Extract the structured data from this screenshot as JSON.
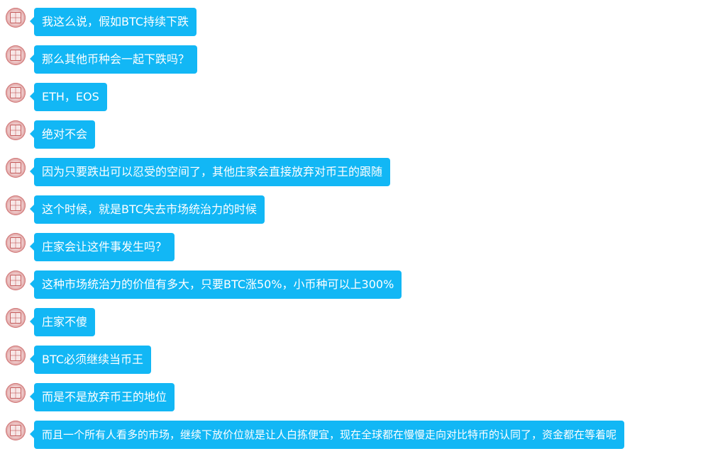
{
  "colors": {
    "bubble_background": "#12b7f5",
    "bubble_text": "#ffffff",
    "page_background": "#ffffff"
  },
  "messages": [
    {
      "text": "我这么说，假如BTC持续下跌",
      "avatar_icon": "seal-avatar-icon"
    },
    {
      "text": "那么其他币种会一起下跌吗？",
      "avatar_icon": "seal-avatar-icon"
    },
    {
      "text": "ETH，EOS",
      "avatar_icon": "seal-avatar-icon"
    },
    {
      "text": "绝对不会",
      "avatar_icon": "seal-avatar-icon"
    },
    {
      "text": "因为只要跌出可以忍受的空间了，其他庄家会直接放弃对币王的跟随",
      "avatar_icon": "seal-avatar-icon"
    },
    {
      "text": "这个时候，就是BTC失去市场统治力的时候",
      "avatar_icon": "seal-avatar-icon"
    },
    {
      "text": "庄家会让这件事发生吗？",
      "avatar_icon": "seal-avatar-icon"
    },
    {
      "text": "这种市场统治力的价值有多大，只要BTC涨50%，小币种可以上300%",
      "avatar_icon": "seal-avatar-icon"
    },
    {
      "text": "庄家不傻",
      "avatar_icon": "seal-avatar-icon"
    },
    {
      "text": "BTC必须继续当币王",
      "avatar_icon": "seal-avatar-icon"
    },
    {
      "text": "而是不是放弃币王的地位",
      "avatar_icon": "seal-avatar-icon"
    },
    {
      "text": "而且一个所有人看多的市场，继续下放价位就是让人白拣便宜，现在全球都在慢慢走向对比特币的认同了，资金都在等着呢",
      "avatar_icon": "seal-avatar-icon"
    }
  ]
}
